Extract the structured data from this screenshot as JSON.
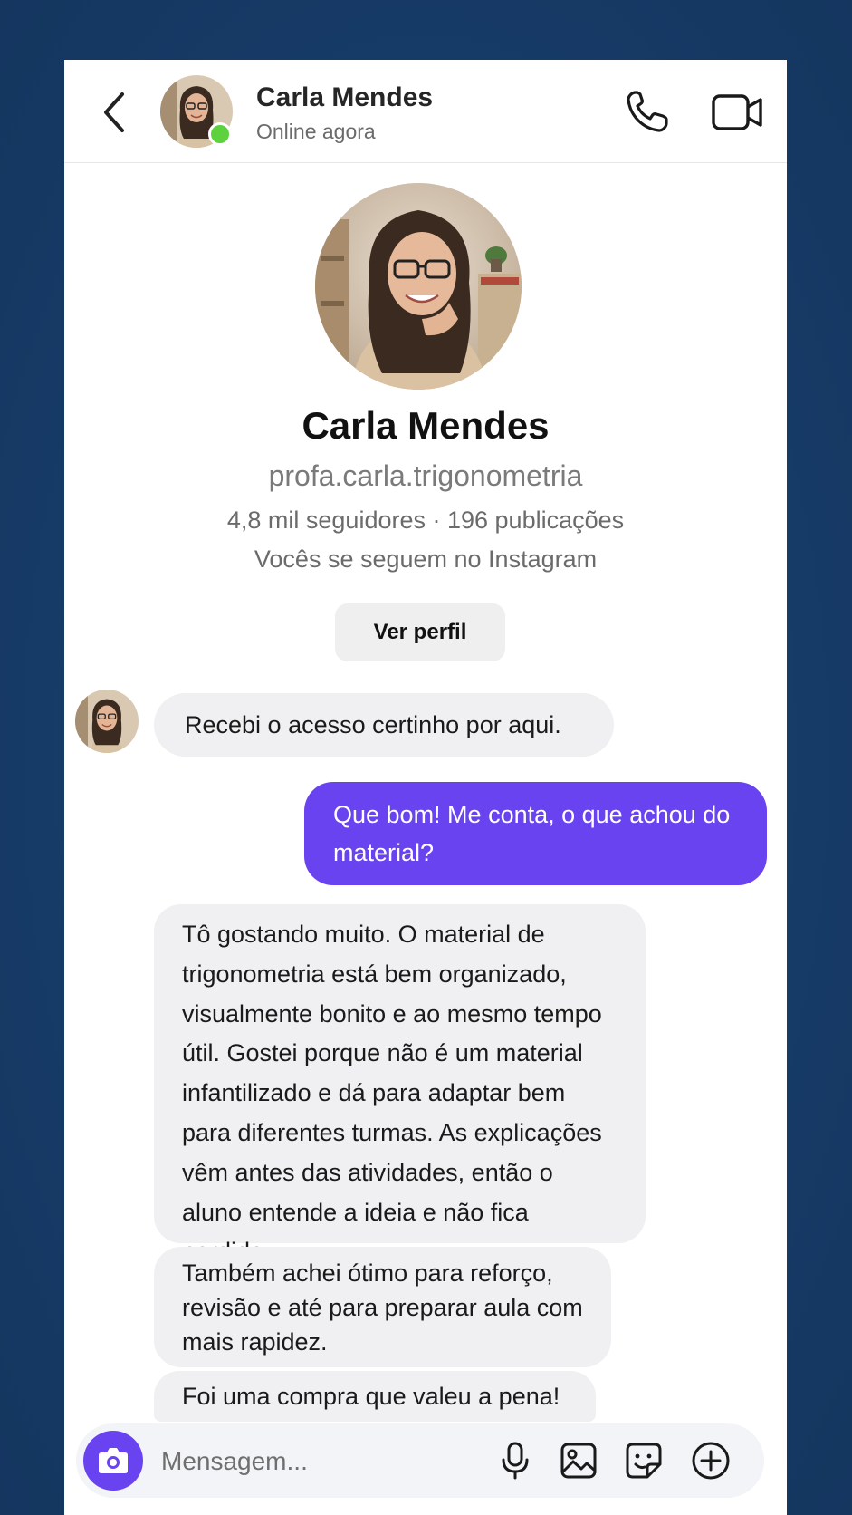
{
  "header": {
    "name": "Carla Mendes",
    "status": "Online agora"
  },
  "profile": {
    "name": "Carla Mendes",
    "handle": "profa.carla.trigonometria",
    "stats": "4,8 mil seguidores · 196 publicações",
    "mutual": "Vocês se seguem no Instagram",
    "view_profile_label": "Ver perfil"
  },
  "messages": [
    {
      "from": "them",
      "text": "Recebi o acesso certinho por aqui."
    },
    {
      "from": "me",
      "text": "Que bom! Me conta, o que achou do material?"
    },
    {
      "from": "them",
      "text": "Tô gostando muito. O material de trigonometria está bem organizado, visualmente bonito e ao mesmo tempo útil. Gostei porque não é um material infantilizado e dá para adaptar bem para diferentes turmas. As explicações vêm antes das atividades, então o aluno entende a ideia e não fica perdido."
    },
    {
      "from": "them",
      "text": "Também achei ótimo para reforço, revisão e até para preparar aula com mais rapidez."
    },
    {
      "from": "them",
      "text": "Foi uma compra que valeu a pena!"
    }
  ],
  "composer": {
    "placeholder": "Mensagem..."
  },
  "colors": {
    "accent": "#6a43f0",
    "online": "#5dd13e",
    "background": "#173d6a",
    "incoming_bubble": "#f0f0f2"
  },
  "icons": [
    "back-icon",
    "phone-icon",
    "video-icon",
    "camera-icon",
    "mic-icon",
    "image-icon",
    "sticker-icon",
    "plus-icon"
  ]
}
